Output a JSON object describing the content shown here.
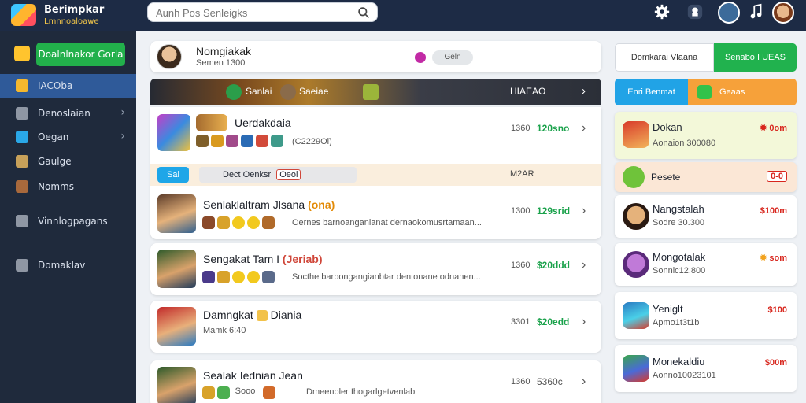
{
  "app": {
    "title": "Berimpkar",
    "subtitle": "Lmnnoaloawe",
    "brand_color": "#1d2b45"
  },
  "search": {
    "placeholder": "Aunh Pos Senleigks"
  },
  "topbar": {
    "icons": [
      "gear-icon",
      "gamepad-icon",
      "globe-avatar-icon",
      "music-icon",
      "user-avatar"
    ]
  },
  "sidebar": {
    "primary_button": "Doalnlnakor Gorla",
    "items": [
      {
        "label": "IACOba",
        "active": true,
        "chevron": false
      },
      {
        "label": "Denoslaian",
        "active": false,
        "chevron": true
      },
      {
        "label": "Oegan",
        "active": false,
        "chevron": true
      },
      {
        "label": "Gaulge",
        "active": false,
        "chevron": false
      },
      {
        "label": "Nomms",
        "active": false,
        "chevron": false
      },
      {
        "label": "Vinnlogpagans",
        "active": false,
        "chevron": false
      },
      {
        "label": "Domaklav",
        "active": false,
        "chevron": false
      }
    ]
  },
  "profile": {
    "name": "Nomgiakak",
    "sub": "Semen 1300",
    "pill": "Geln"
  },
  "banner": {
    "left_label": "Sanlai",
    "mid_label": "Saeiae",
    "right_label": "HIAEAO"
  },
  "games": [
    {
      "title": "Uerdakdaia",
      "tag": "",
      "desc": "(C2229Ol)",
      "meta1": "1360",
      "meta2": "120sno"
    },
    {
      "title": "Senlaklaltram Jlsana",
      "tag": "(ona)",
      "desc": "Oernes barnoanganlanat dernaokomusrtamaan...",
      "meta1": "1300",
      "meta2": "129srid"
    },
    {
      "title": "Sengakat Tam I",
      "tag": "(Jeriab)",
      "desc": "Socthe barbongangianbtar dentonane odnanen...",
      "meta1": "1360",
      "meta2": "$20ddd"
    },
    {
      "title": "Damngkat",
      "tag": "Diania",
      "desc": "Mamk 6:40",
      "meta1": "3301",
      "meta2": "$20edd"
    },
    {
      "title": "Sealak Iednian Jean",
      "tag": "",
      "desc": "Dmeenoler Ihogarlgetvenlab",
      "meta1": "1360",
      "meta2": "5360c"
    }
  ],
  "strip": {
    "tab": "Sai",
    "field": "Dect Oenksr",
    "field_badge": "Oeol",
    "right": "M2AR"
  },
  "extra_chip_text": "Sooo",
  "right": {
    "tabs": [
      "Domkarai Vlaana",
      "Senabo I UEAS"
    ],
    "categories": [
      "Enri Benmat",
      "Geaas"
    ],
    "items": [
      {
        "name": "Dokan",
        "sub": "Aonaion 300080",
        "price": "0om",
        "featured": true
      },
      {
        "name": "Pesete",
        "sub": "",
        "price": "0-0",
        "featured": false
      },
      {
        "name": "Nangstalah",
        "sub": "Sodre 30.300",
        "price": "$100m",
        "featured": false
      },
      {
        "name": "Mongotalak",
        "sub": "Sonnic12.800",
        "price": "som",
        "featured": false
      },
      {
        "name": "Yeniglt",
        "sub": "Apmo1t3t1b",
        "price": "$100",
        "featured": false
      },
      {
        "name": "Monekaldiu",
        "sub": "Aonno10023101",
        "price": "$00m",
        "featured": false
      }
    ]
  }
}
